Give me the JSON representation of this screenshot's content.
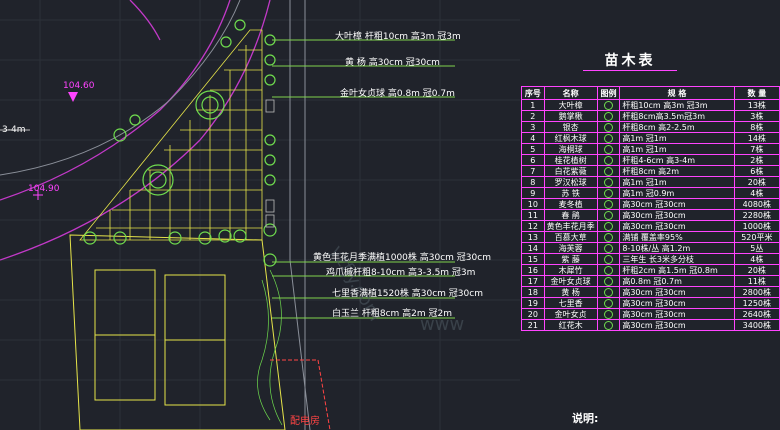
{
  "colors": {
    "background": "#20232b",
    "plan_green": "#6fdc4e",
    "plan_yellow": "#e6e44a",
    "table_magenta": "#ff44ff",
    "road_magenta": "#c239c8"
  },
  "plan_labels": {
    "top_1": "大叶樟  杆粗10cm  高3m        冠3m",
    "top_2": "黄  杨        高30cm  冠30cm",
    "top_3": "金叶女贞球       高0.8m  冠0.7m",
    "mid_1": "黄色丰花月季满植1000株 高30cm 冠30cm",
    "mid_2": "鸡爪槭杆粗8-10cm  高3-3.5m 冠3m",
    "mid_3": "七里香满植1520株 高30cm 冠30cm",
    "mid_4": "白玉兰      杆粗8cm 高2m  冠2m",
    "elev_1": "104.60",
    "elev_2": "104.90",
    "dim_left": "3-4m",
    "room": "配电房"
  },
  "table": {
    "title": "苗木表",
    "headers": [
      "序号",
      "名称",
      "图例",
      "规      格",
      "数  量"
    ],
    "rows": [
      [
        "1",
        "大叶樟",
        "杆粗10cm    高3m      冠3m",
        "13株"
      ],
      [
        "2",
        "鹅掌楸",
        "杆粗8cm高3.5m冠3m",
        "3株"
      ],
      [
        "3",
        "银杏",
        "杆粗8cm 高2-2.5m",
        "8株"
      ],
      [
        "4",
        "红枫木球",
        "高1m 冠1m",
        "14株"
      ],
      [
        "5",
        "海桐球",
        "高1m 冠1m",
        "7株"
      ],
      [
        "6",
        "桂花植树",
        "杆粗4-6cm 高3-4m",
        "2株"
      ],
      [
        "7",
        "白花紫薇",
        "杆粗8cm 高2m",
        "6株"
      ],
      [
        "8",
        "罗汉松球",
        "高1m 冠1m",
        "20株"
      ],
      [
        "9",
        "苏  铁",
        "高1m 冠0.9m",
        "4株"
      ],
      [
        "10",
        "麦冬植",
        "高30cm 冠30cm",
        "4080株"
      ],
      [
        "11",
        "春  鹃",
        "高30cm 冠30cm",
        "2280株"
      ],
      [
        "12",
        "黄色丰花月季",
        "高30cm 冠30cm",
        "1000株"
      ],
      [
        "13",
        "百慕大草",
        "满铺    覆盖率95%",
        "520平米"
      ],
      [
        "14",
        "海芙蓉",
        "8-10株/丛  高1.2m",
        "5丛"
      ],
      [
        "15",
        "紫  藤",
        "三年生  长3米多分枝",
        "4株"
      ],
      [
        "16",
        "木犀竹",
        "杆粗2cm 高1.5m 冠0.8m",
        "20株"
      ],
      [
        "17",
        "金叶女贞球",
        "高0.8m 冠0.7m",
        "11株"
      ],
      [
        "18",
        "黄  杨",
        "高30cm 冠30cm",
        "2800株"
      ],
      [
        "19",
        "七里香",
        "高30cm 冠30cm",
        "1250株"
      ],
      [
        "20",
        "金叶女贞",
        "高30cm 冠30cm",
        "2640株"
      ],
      [
        "21",
        "红花木",
        "高30cm 冠30cm",
        "3400株"
      ]
    ]
  },
  "notes": {
    "title": "说明:"
  }
}
